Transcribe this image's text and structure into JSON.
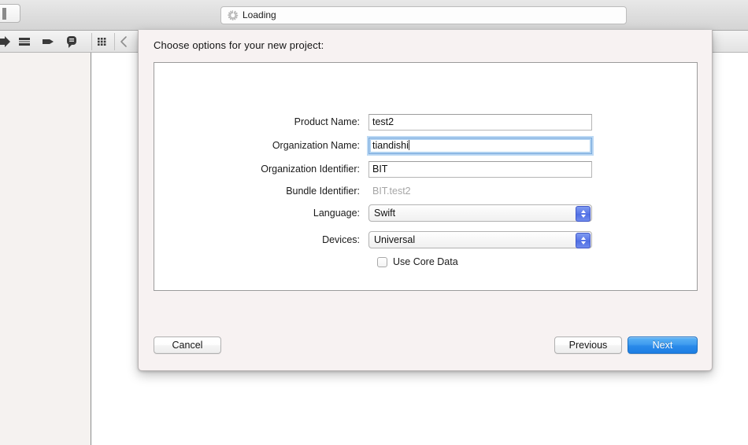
{
  "window": {
    "status_field": {
      "text": "Loading",
      "icon": "spinner-icon"
    },
    "left_button_icon": "sidebar-toggle-icon"
  },
  "toolbar": {
    "items": [
      {
        "icon": "run-arrow-icon"
      },
      {
        "icon": "list-view-icon"
      },
      {
        "icon": "tag-icon"
      },
      {
        "icon": "comment-bubble-icon"
      },
      {
        "icon": "grid-view-icon"
      },
      {
        "icon": "chevron-left-icon"
      }
    ]
  },
  "dialog": {
    "title": "Choose options for your new project:",
    "fields": [
      {
        "label": "Product Name:",
        "value": "test2",
        "type": "text",
        "focused": false,
        "name": "product-name"
      },
      {
        "label": "Organization Name:",
        "value": "tiandishi",
        "type": "text",
        "focused": true,
        "name": "organization-name"
      },
      {
        "label": "Organization Identifier:",
        "value": "BIT",
        "type": "text",
        "focused": false,
        "name": "organization-identifier"
      },
      {
        "label": "Bundle Identifier:",
        "value": "BIT.test2",
        "type": "static",
        "focused": false,
        "name": "bundle-identifier"
      },
      {
        "label": "Language:",
        "value": "Swift",
        "type": "popup",
        "focused": false,
        "name": "language"
      },
      {
        "label": "Devices:",
        "value": "Universal",
        "type": "popup",
        "focused": false,
        "name": "devices"
      }
    ],
    "checkbox": {
      "label": "Use Core Data",
      "checked": false
    },
    "buttons": {
      "cancel": "Cancel",
      "previous": "Previous",
      "next": "Next"
    }
  },
  "colors": {
    "accent_blue": "#2a8ae9",
    "sheet_background": "#f7f2f2",
    "navigator_background": "#f5f2f0",
    "focus_ring": "#aed0f0",
    "popup_arrow_blue": "#5a77e8",
    "muted_text": "#a6a6a6"
  }
}
